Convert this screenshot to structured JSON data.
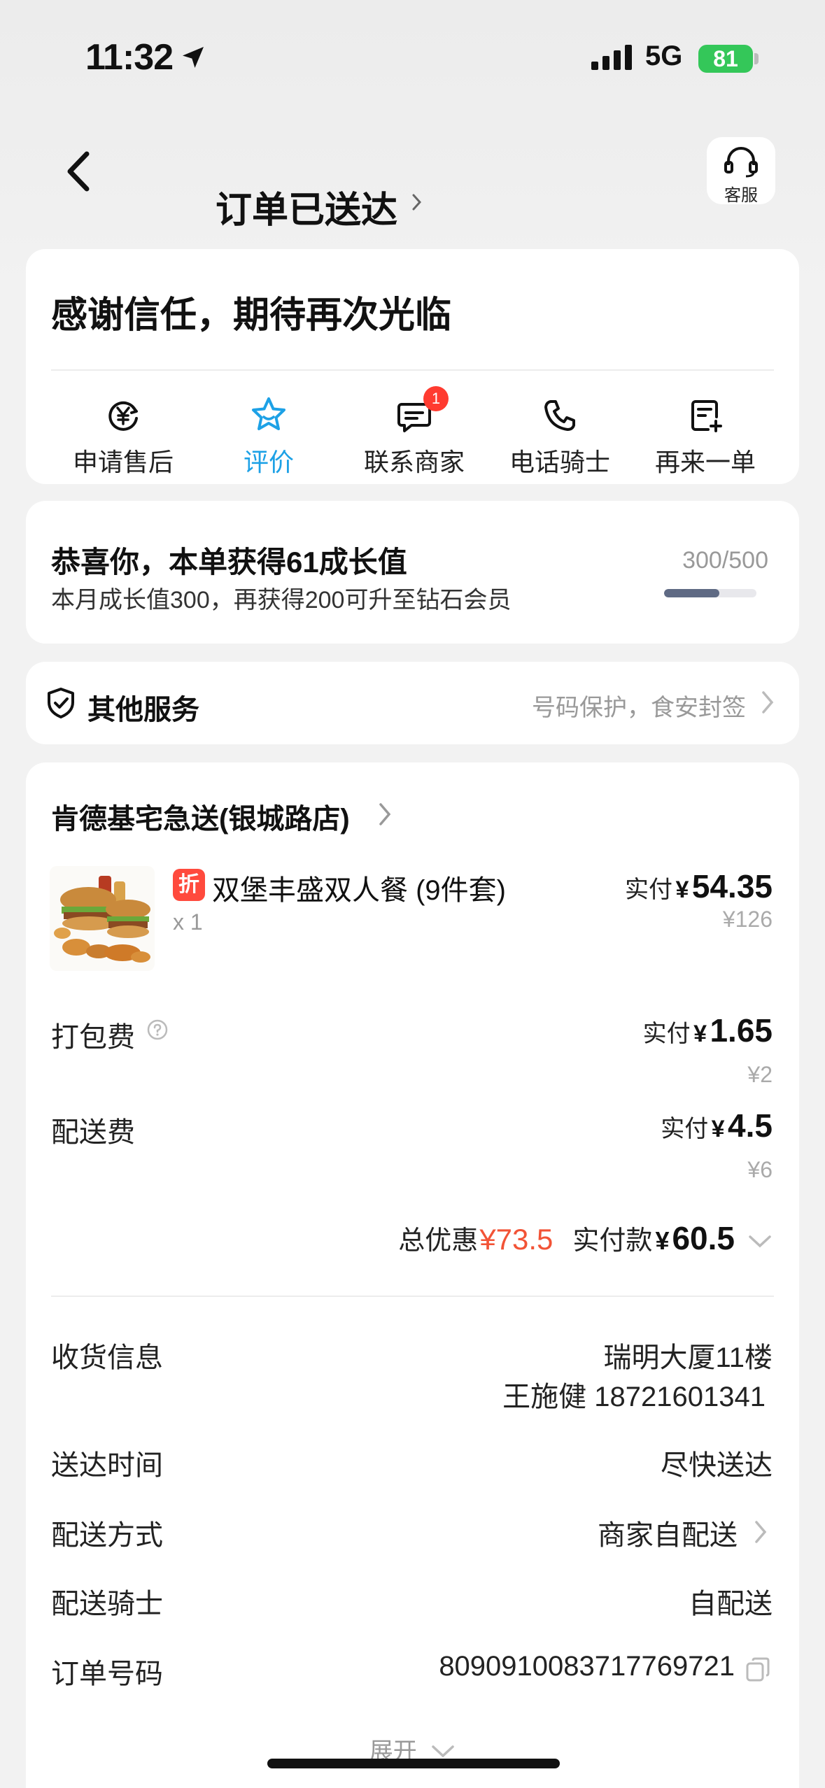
{
  "status_bar": {
    "time": "11:32",
    "network": "5G",
    "battery": "81"
  },
  "header": {
    "title": "订单已送达",
    "service_label": "客服"
  },
  "thanks_card": {
    "title": "感谢信任，期待再次光临",
    "actions": [
      {
        "label": "申请售后",
        "icon": "yen-refund-icon"
      },
      {
        "label": "评价",
        "icon": "star-icon",
        "active": true
      },
      {
        "label": "联系商家",
        "icon": "chat-icon",
        "badge": "1"
      },
      {
        "label": "电话骑士",
        "icon": "phone-icon"
      },
      {
        "label": "再来一单",
        "icon": "reorder-icon"
      }
    ]
  },
  "growth_card": {
    "title": "恭喜你，本单获得61成长值",
    "subtitle": "本月成长值300，再获得200可升至钻石会员",
    "progress_text": "300/500",
    "progress_fraction": 0.6
  },
  "services_card": {
    "title": "其他服务",
    "description": "号码保护，食安封签"
  },
  "order_card": {
    "store_name": "肯德基宅急送(银城路店)",
    "item": {
      "tag": "折",
      "name": "双堡丰盛双人餐 (9件套)",
      "qty": "x 1",
      "paid_label": "实付",
      "yen": "¥",
      "paid_value": "54.35",
      "original_price": "¥126"
    },
    "packing_fee": {
      "label": "打包费",
      "paid_label": "实付",
      "yen": "¥",
      "paid_value": "1.65",
      "original_price": "¥2"
    },
    "delivery_fee": {
      "label": "配送费",
      "paid_label": "实付",
      "yen": "¥",
      "paid_value": "4.5",
      "original_price": "¥6"
    },
    "total": {
      "discount_label": "总优惠",
      "discount_value": "¥73.5",
      "paid_label": "实付款",
      "paid_yen": "¥",
      "paid_value": "60.5"
    },
    "info": {
      "receiver_label": "收货信息",
      "receiver_address": "瑞明大厦11楼",
      "receiver_contact": "王施健 18721601341",
      "time_label": "送达时间",
      "time_value": "尽快送达",
      "method_label": "配送方式",
      "method_value": "商家自配送",
      "rider_label": "配送骑士",
      "rider_value": "自配送",
      "order_no_label": "订单号码",
      "order_no_value": "8090910083717769721"
    },
    "expand_label": "展开"
  },
  "colors": {
    "accent_blue": "#1da1e6",
    "discount_red": "#f25336",
    "badge_red": "#ff3b30",
    "battery_green": "#34c759"
  }
}
